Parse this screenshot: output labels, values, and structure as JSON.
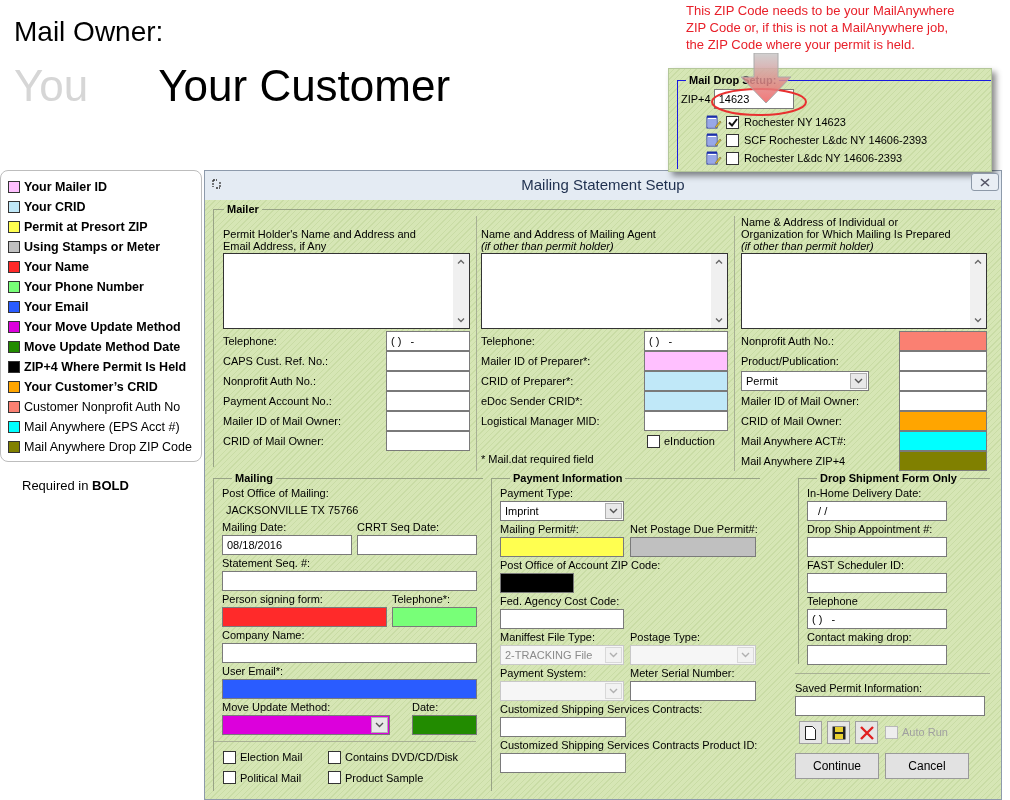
{
  "header": {
    "title": "Mail Owner:",
    "choices": [
      {
        "label": "You",
        "selected": false
      },
      {
        "label": "Your Customer",
        "selected": true
      }
    ]
  },
  "callout": {
    "lines": [
      "This ZIP Code needs to be your MailAnywhere",
      "ZIP Code or, if this is not a MailAnywhere job,",
      "the ZIP Code where your permit is held."
    ]
  },
  "mail_drop_setup": {
    "title": "Mail Drop Setup:",
    "zip_label": "ZIP+4",
    "zip_value": "14623",
    "offices": [
      {
        "label": "Rochester NY 14623",
        "checked": true
      },
      {
        "label": "SCF Rochester L&dc NY 14606-2393",
        "checked": false
      },
      {
        "label": "Rochester L&dc NY 14606-2393",
        "checked": false
      }
    ]
  },
  "legend": {
    "items": [
      {
        "label": "Your Mailer ID",
        "color": "#ffc0ff",
        "required": true
      },
      {
        "label": "Your CRID",
        "color": "#c0e8f8",
        "required": true
      },
      {
        "label": "Permit at Presort ZIP",
        "color": "#ffff50",
        "required": true
      },
      {
        "label": "Using Stamps or Meter",
        "color": "#c0c0c0",
        "required": true
      },
      {
        "label": "Your Name",
        "color": "#ff2a2a",
        "required": true
      },
      {
        "label": "Your Phone Number",
        "color": "#78ff78",
        "required": true
      },
      {
        "label": "Your Email",
        "color": "#2a5cff",
        "required": true
      },
      {
        "label": "Your Move Update Method",
        "color": "#dc00dc",
        "required": true
      },
      {
        "label": "Move Update Method Date",
        "color": "#228b00",
        "required": true
      },
      {
        "label": "ZIP+4 Where Permit Is Held",
        "color": "#000000",
        "required": true
      },
      {
        "label": "Your Customer’s CRID",
        "color": "#ffa500",
        "required": true
      },
      {
        "label": "Customer Nonprofit Auth No",
        "color": "#fa8072",
        "required": false
      },
      {
        "label": "Mail Anywhere (EPS Acct #)",
        "color": "#00ffff",
        "required": false
      },
      {
        "label": "Mail Anywhere Drop ZIP Code",
        "color": "#808000",
        "required": false
      }
    ],
    "note": "Required in **BOLD**"
  },
  "dialog": {
    "title": "Mailing Statement Setup",
    "mailer": {
      "title": "Mailer",
      "columns": [
        {
          "heading": [
            "Permit Holder's Name and Address and",
            "Email Address, if Any"
          ],
          "fields": [
            {
              "kind": "text",
              "label": "Telephone:",
              "value": "( )   -"
            },
            {
              "kind": "text",
              "label": "CAPS Cust. Ref. No.:"
            },
            {
              "kind": "text",
              "label": "Nonprofit Auth No.:"
            },
            {
              "kind": "text",
              "label": "Payment Account No.:"
            },
            {
              "kind": "text",
              "label": "Mailer ID of Mail Owner:"
            },
            {
              "kind": "text",
              "label": "CRID of Mail Owner:"
            }
          ]
        },
        {
          "heading": [
            "Name and Address of Mailing Agent"
          ],
          "note": "(if other than permit holder)",
          "fields": [
            {
              "kind": "text",
              "label": "Telephone:",
              "value": "( )   -"
            },
            {
              "kind": "text",
              "label": "Mailer ID of Preparer*:",
              "color": "#ffc0ff"
            },
            {
              "kind": "text",
              "label": "CRID of Preparer*:",
              "color": "#c0e8f8"
            },
            {
              "kind": "text",
              "label": "eDoc Sender CRID*:",
              "color": "#c0e8f8"
            },
            {
              "kind": "text",
              "label": "Logistical Manager MID:"
            }
          ],
          "checkbox": {
            "label": "eInduction",
            "checked": false
          },
          "footnote": "* Mail.dat required field"
        },
        {
          "heading": [
            "Name & Address of Individual or",
            "Organization for Which Mailing Is Prepared"
          ],
          "note": "(if other than permit holder)",
          "fields": [
            {
              "kind": "text",
              "label": "Nonprofit Auth No.:",
              "color": "#fa8072"
            },
            {
              "kind": "text",
              "label": "Product/Publication:"
            },
            {
              "kind": "select",
              "value": "Permit"
            },
            {
              "kind": "text",
              "label": "Mailer ID of Mail Owner:"
            },
            {
              "kind": "text",
              "label": "CRID of Mail Owner:",
              "color": "#ffa500"
            },
            {
              "kind": "text",
              "label": "Mail Anywhere ACT#:",
              "color": "#00ffff"
            },
            {
              "kind": "text",
              "label": "Mail Anywhere ZIP+4",
              "color": "#808000"
            }
          ]
        }
      ]
    },
    "mailing": {
      "title": "Mailing",
      "post_office_label": "Post Office of Mailing:",
      "post_office": "JACKSONVILLE TX 75766",
      "rows": [
        [
          {
            "kind": "text",
            "label": "Mailing Date:",
            "value": "08/18/2016"
          },
          {
            "kind": "text",
            "label": "CRRT Seq Date:"
          }
        ],
        [
          {
            "kind": "text",
            "label": "Statement Seq. #:"
          }
        ],
        [
          {
            "kind": "text",
            "label": "Person signing form:",
            "color": "#ff2a2a"
          },
          {
            "kind": "text",
            "label": "Telephone*:",
            "color": "#78ff78"
          }
        ],
        [
          {
            "kind": "text",
            "label": "Company Name:"
          }
        ],
        [
          {
            "kind": "text",
            "label": "User Email*:",
            "color": "#2a5cff"
          }
        ],
        [
          {
            "kind": "select",
            "label": "Move Update Method:",
            "color": "#dc00dc"
          },
          {
            "kind": "text",
            "label": "Date:",
            "color": "#228b00"
          }
        ]
      ],
      "checkboxes": [
        {
          "label": "Election Mail",
          "checked": false
        },
        {
          "label": "Contains DVD/CD/Disk",
          "checked": false
        },
        {
          "label": "Political Mail",
          "checked": false
        },
        {
          "label": "Product Sample",
          "checked": false
        }
      ]
    },
    "payment": {
      "title": "Payment Information",
      "rows": [
        [
          {
            "kind": "select",
            "label": "Payment Type:",
            "value": "Imprint",
            "disabled": false
          }
        ],
        [
          {
            "kind": "text",
            "label": "Mailing Permit#:",
            "color": "#ffff50",
            "disabled": false
          },
          {
            "kind": "text",
            "label": "Net Postage Due Permit#:",
            "color": "#c0c0c0",
            "disabled": false
          }
        ],
        [
          {
            "kind": "text",
            "label": "Post Office of Account ZIP Code:",
            "color": "#000000",
            "disabled": false
          }
        ],
        [
          {
            "kind": "text",
            "label": "Fed. Agency Cost Code:",
            "disabled": false
          }
        ],
        [
          {
            "kind": "select",
            "label": "Maniffest File Type:",
            "value": "2-TRACKING File",
            "disabled": true
          },
          {
            "kind": "select",
            "label": "Postage Type:",
            "disabled": true
          }
        ],
        [
          {
            "kind": "select",
            "label": "Payment System:",
            "disabled": true
          },
          {
            "kind": "text",
            "label": "Meter Serial Number:",
            "disabled": false
          }
        ],
        [
          {
            "kind": "text",
            "label": "Customized Shipping Services Contracts:",
            "disabled": false
          }
        ],
        [
          {
            "kind": "text",
            "label": "Customized Shipping Services Contracts Product ID:",
            "disabled": false
          }
        ]
      ]
    },
    "drop_shipment": {
      "title": "Drop Shipment Form Only",
      "fields": [
        {
          "kind": "text",
          "label": "In-Home Delivery Date:",
          "value": "  / /"
        },
        {
          "kind": "text",
          "label": "Drop Ship Appointment #:"
        },
        {
          "kind": "text",
          "label": "FAST Scheduler ID:"
        },
        {
          "kind": "text",
          "label": "Telephone",
          "value": "( )   -"
        },
        {
          "kind": "text",
          "label": "Contact making drop:"
        }
      ]
    },
    "saved_permit": {
      "label": "Saved Permit Information:",
      "auto_run": {
        "label": "Auto Run",
        "checked": false,
        "disabled": true
      }
    },
    "buttons": [
      {
        "label": "Continue"
      },
      {
        "label": "Cancel"
      }
    ]
  }
}
